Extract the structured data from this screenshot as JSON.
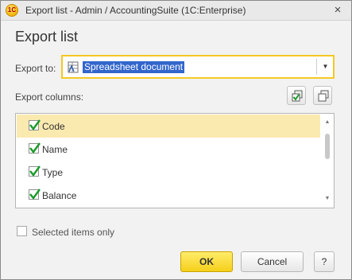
{
  "window": {
    "title": "Export list - Admin / AccountingSuite  (1C:Enterprise)",
    "logo_text": "1C",
    "close_glyph": "×"
  },
  "dialog": {
    "heading": "Export list",
    "export_to_label": "Export to:",
    "export_to_value": "Spreadsheet document",
    "export_to_icon": "spreadsheet-icon",
    "dropdown_glyph": "▼",
    "columns_label": "Export columns:",
    "check_all_icon": "check-all-icon",
    "uncheck_all_icon": "uncheck-all-icon",
    "columns": [
      {
        "label": "Code",
        "checked": true,
        "selected": true
      },
      {
        "label": "Name",
        "checked": true,
        "selected": false
      },
      {
        "label": "Type",
        "checked": true,
        "selected": false
      },
      {
        "label": "Balance",
        "checked": true,
        "selected": false
      }
    ],
    "scroll_up_glyph": "▲",
    "scroll_down_glyph": "▼",
    "selected_only_label": "Selected items only",
    "selected_only_checked": false,
    "ok_label": "OK",
    "cancel_label": "Cancel",
    "help_label": "?"
  },
  "colors": {
    "accent_yellow": "#f5c824",
    "selection_row": "#fbeab0",
    "text_selection": "#3366cc",
    "check_green": "#1a9a2a"
  }
}
